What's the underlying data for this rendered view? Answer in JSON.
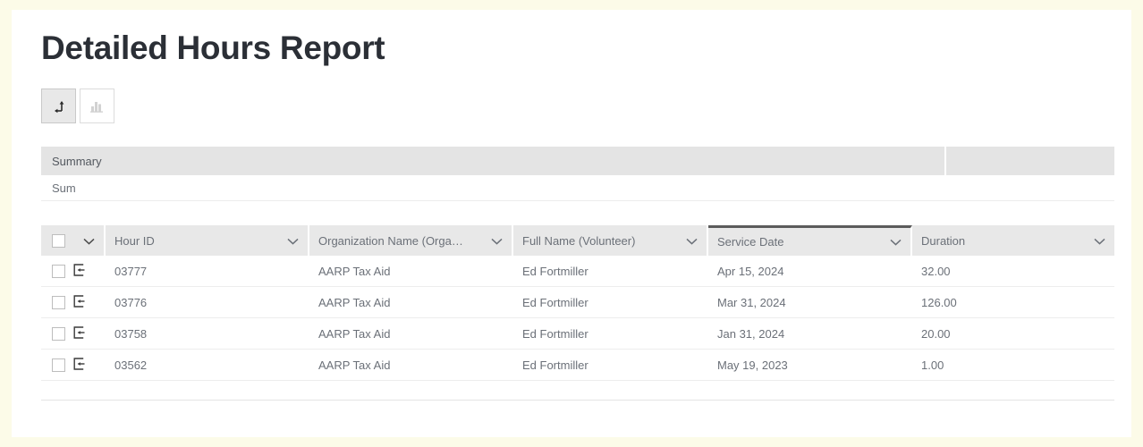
{
  "page": {
    "title": "Detailed Hours Report",
    "frame_color": "#fcfbe8"
  },
  "toolbar": {
    "buttons": [
      {
        "name": "table-view-button",
        "icon": "transpose-arrow-icon",
        "active": true
      },
      {
        "name": "chart-view-button",
        "icon": "bar-chart-icon",
        "active": false
      }
    ]
  },
  "summary": {
    "header": "Summary",
    "header_side": "",
    "row_label": "Sum",
    "row_value": ""
  },
  "table": {
    "columns": [
      {
        "label": "",
        "key": "select",
        "sorted": false
      },
      {
        "label": "Hour ID",
        "key": "hour_id",
        "sorted": false
      },
      {
        "label": "Organization Name (Orga…",
        "key": "org_name",
        "sorted": false
      },
      {
        "label": "Full Name (Volunteer)",
        "key": "full_name",
        "sorted": false
      },
      {
        "label": "Service Date",
        "key": "service_date",
        "sorted": true
      },
      {
        "label": "Duration",
        "key": "duration",
        "sorted": false
      }
    ],
    "rows": [
      {
        "hour_id": "03777",
        "org_name": "AARP Tax Aid",
        "full_name": "Ed Fortmiller",
        "service_date": "Apr 15, 2024",
        "duration": "32.00"
      },
      {
        "hour_id": "03776",
        "org_name": "AARP Tax Aid",
        "full_name": "Ed Fortmiller",
        "service_date": "Mar 31, 2024",
        "duration": "126.00"
      },
      {
        "hour_id": "03758",
        "org_name": "AARP Tax Aid",
        "full_name": "Ed Fortmiller",
        "service_date": "Jan 31, 2024",
        "duration": "20.00"
      },
      {
        "hour_id": "03562",
        "org_name": "AARP Tax Aid",
        "full_name": "Ed Fortmiller",
        "service_date": "May 19, 2023",
        "duration": "1.00"
      }
    ]
  },
  "colors": {
    "header_bg": "#e8e8e8",
    "summary_bg": "#e4e4e4",
    "text": "#6b7078",
    "title": "#2b2f36",
    "sort_indicator": "#5b5b5b"
  }
}
